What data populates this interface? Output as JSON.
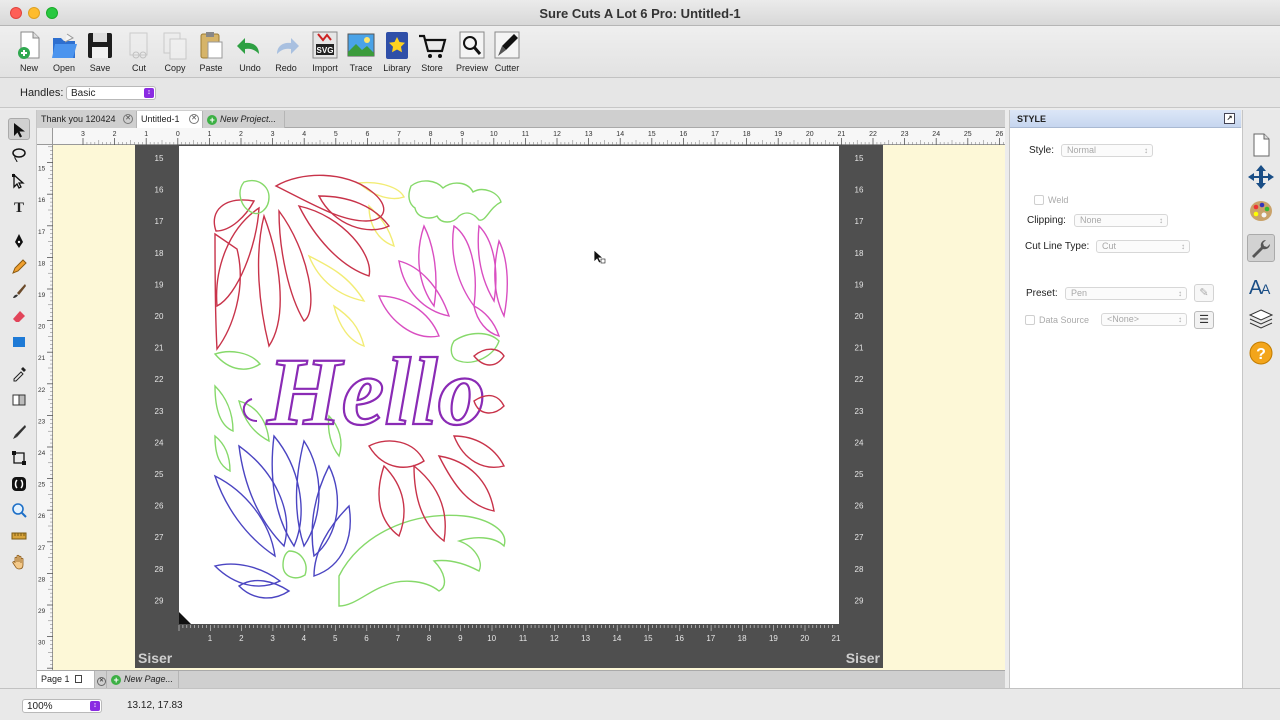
{
  "window": {
    "title": "Sure Cuts A Lot 6 Pro: Untitled-1"
  },
  "toolbar": {
    "buttons": [
      {
        "label": "New",
        "icon": "new-document-icon"
      },
      {
        "label": "Open",
        "icon": "open-folder-icon"
      },
      {
        "label": "Save",
        "icon": "save-icon"
      },
      {
        "label": "Cut",
        "icon": "scissors-icon"
      },
      {
        "label": "Copy",
        "icon": "copy-icon"
      },
      {
        "label": "Paste",
        "icon": "paste-icon"
      },
      {
        "label": "Undo",
        "icon": "undo-icon"
      },
      {
        "label": "Redo",
        "icon": "redo-icon"
      },
      {
        "label": "Import",
        "icon": "import-svg-icon"
      },
      {
        "label": "Trace",
        "icon": "trace-icon"
      },
      {
        "label": "Library",
        "icon": "library-icon"
      },
      {
        "label": "Store",
        "icon": "cart-icon"
      },
      {
        "label": "Preview",
        "icon": "magnifier-preview-icon"
      },
      {
        "label": "Cutter",
        "icon": "cutter-blade-icon"
      }
    ]
  },
  "handles": {
    "label": "Handles:",
    "value": "Basic"
  },
  "doc_tabs": [
    {
      "label": "Thank you 120424"
    },
    {
      "label": "Untitled-1",
      "active": true
    },
    {
      "label": "New Project..."
    }
  ],
  "ruler": {
    "top_labels": [
      "3",
      "2",
      "1",
      "0",
      "1",
      "2",
      "3",
      "4",
      "5",
      "6",
      "7",
      "8",
      "9",
      "10",
      "11",
      "12",
      "13",
      "14",
      "15",
      "16",
      "17",
      "18",
      "19",
      "20",
      "21",
      "22",
      "23",
      "24",
      "25",
      "26"
    ],
    "left_labels": [
      "14",
      "15",
      "16",
      "17",
      "18",
      "19",
      "20",
      "21",
      "22",
      "23",
      "24",
      "25",
      "26",
      "27",
      "28",
      "29",
      "30",
      "31"
    ]
  },
  "mat": {
    "brand": "Siser",
    "side_numbers": [
      "15",
      "16",
      "17",
      "18",
      "19",
      "20",
      "21",
      "22",
      "23",
      "24",
      "25",
      "26",
      "27",
      "28",
      "29"
    ],
    "bottom_numbers": [
      "1",
      "2",
      "3",
      "4",
      "5",
      "6",
      "7",
      "8",
      "9",
      "10",
      "11",
      "12",
      "13",
      "14",
      "15",
      "16",
      "17",
      "18",
      "19",
      "20",
      "21"
    ]
  },
  "design": {
    "text": "Hello"
  },
  "page_tabs": [
    {
      "label": "Page 1"
    },
    {
      "label": "New Page..."
    }
  ],
  "status": {
    "zoom": "100%",
    "coordinates": "13.12, 17.83"
  },
  "style_panel": {
    "title": "STYLE",
    "style_label": "Style:",
    "style_value": "Normal",
    "weld_label": "Weld",
    "clipping_label": "Clipping:",
    "clipping_value": "None",
    "cutline_label": "Cut Line Type:",
    "cutline_value": "Cut",
    "preset_label": "Preset:",
    "preset_value": "Pen",
    "datasource_label": "Data Source",
    "datasource_value": "<None>"
  },
  "colors": {
    "mat": "#4f4f4f",
    "canvas_bg": "#fdf8d7",
    "red_shape": "#c8334a",
    "green_shape": "#86d96a",
    "yellow_shape": "#f2ec74",
    "pink_shape": "#d94ec1",
    "purple_text": "#8a2bb5",
    "blue_shape": "#4b45c2"
  }
}
